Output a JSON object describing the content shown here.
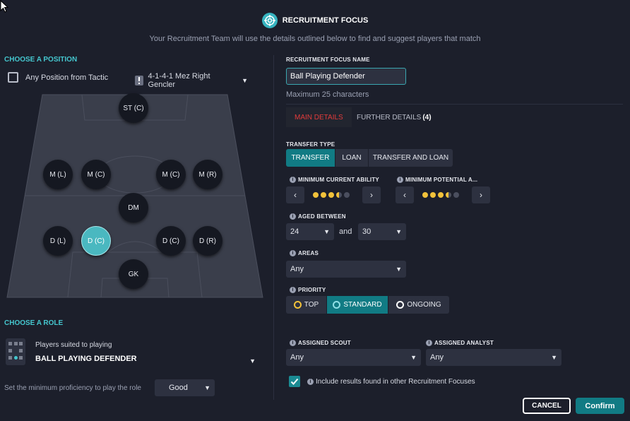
{
  "header": {
    "title": "RECRUITMENT FOCUS",
    "subtitle": "Your Recruitment Team will use the details outlined below to find and suggest players that match"
  },
  "position_section": {
    "label": "CHOOSE A POSITION",
    "any_position_label": "Any Position from Tactic",
    "tactic_value": "4-1-4-1 Mez Right Gencler",
    "positions": [
      {
        "id": "st-c",
        "label": "ST (C)",
        "active": false
      },
      {
        "id": "m-l",
        "label": "M (L)",
        "active": false
      },
      {
        "id": "m-c-left",
        "label": "M (C)",
        "active": false
      },
      {
        "id": "m-c-right",
        "label": "M (C)",
        "active": false
      },
      {
        "id": "m-r",
        "label": "M (R)",
        "active": false
      },
      {
        "id": "dm",
        "label": "DM",
        "active": false
      },
      {
        "id": "d-l",
        "label": "D (L)",
        "active": false
      },
      {
        "id": "d-c-left",
        "label": "D (C)",
        "active": true
      },
      {
        "id": "d-c-right",
        "label": "D (C)",
        "active": false
      },
      {
        "id": "d-r",
        "label": "D (R)",
        "active": false
      },
      {
        "id": "gk",
        "label": "GK",
        "active": false
      }
    ]
  },
  "role_section": {
    "label": "CHOOSE A ROLE",
    "suited_label": "Players suited to playing",
    "role_value": "BALL PLAYING DEFENDER",
    "proficiency_label": "Set the minimum proficiency to play the role",
    "proficiency_value": "Good"
  },
  "focus": {
    "name_label": "RECRUITMENT FOCUS NAME",
    "name_value": "Ball Playing Defender",
    "name_hint": "Maximum 25 characters",
    "tabs": [
      {
        "label": "MAIN DETAILS",
        "active": true
      },
      {
        "label": "FURTHER DETAILS",
        "badge": "(4)",
        "active": false
      }
    ],
    "transfer_type_label": "TRANSFER TYPE",
    "transfer_options": [
      {
        "label": "TRANSFER",
        "active": true
      },
      {
        "label": "LOAN",
        "active": false
      },
      {
        "label": "TRANSFER AND LOAN",
        "active": false
      }
    ],
    "min_ca_label": "MINIMUM CURRENT ABILITY",
    "min_ca_stars": 3.5,
    "min_pa_label": "MINIMUM POTENTIAL A...",
    "min_pa_stars": 3.5,
    "aged_label": "AGED BETWEEN",
    "age_from": "24",
    "age_and": "and",
    "age_to": "30",
    "areas_label": "AREAS",
    "areas_value": "Any",
    "priority_label": "PRIORITY",
    "priority_options": [
      {
        "label": "TOP",
        "active": false,
        "icon": "target-gold-icon"
      },
      {
        "label": "STANDARD",
        "active": true,
        "icon": "target-teal-icon"
      },
      {
        "label": "ONGOING",
        "active": false,
        "icon": "target-white-icon"
      }
    ],
    "scout_label": "ASSIGNED SCOUT",
    "scout_value": "Any",
    "analyst_label": "ASSIGNED ANALYST",
    "analyst_value": "Any",
    "include_label": "Include results found in other Recruitment Focuses",
    "include_checked": true
  },
  "footer": {
    "cancel_label": "CANCEL",
    "confirm_label": "Confirm"
  },
  "colors": {
    "accent": "#45c7cf",
    "primary_button": "#117b84",
    "active_tab": "#e23b3b",
    "background": "#1c1f2b"
  }
}
